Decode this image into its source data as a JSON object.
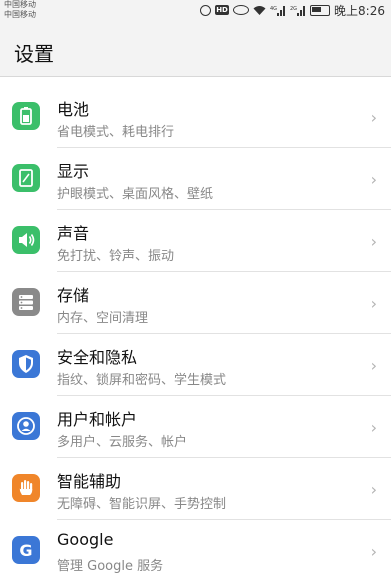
{
  "status_bar": {
    "carrier_1": "中国移动",
    "carrier_2": "中国移动",
    "time": "晚上8:26",
    "icons": [
      "alarm-icon",
      "hd-icon",
      "eye-icon",
      "wifi-icon",
      "signal-4g-icon",
      "signal-2g-icon",
      "battery-icon"
    ]
  },
  "header": {
    "title": "设置"
  },
  "settings": [
    {
      "title": "电池",
      "subtitle": "省电模式、耗电排行",
      "icon": "battery-icon",
      "color": "#3bbf6a"
    },
    {
      "title": "显示",
      "subtitle": "护眼模式、桌面风格、壁纸",
      "icon": "display-icon",
      "color": "#3bbf6a"
    },
    {
      "title": "声音",
      "subtitle": "免打扰、铃声、振动",
      "icon": "speaker-icon",
      "color": "#3bbf6a"
    },
    {
      "title": "存储",
      "subtitle": "内存、空间清理",
      "icon": "storage-icon",
      "color": "#8a8a8a"
    },
    {
      "title": "安全和隐私",
      "subtitle": "指纹、锁屏和密码、学生模式",
      "icon": "shield-icon",
      "color": "#3b77d6"
    },
    {
      "title": "用户和帐户",
      "subtitle": "多用户、云服务、帐户",
      "icon": "user-icon",
      "color": "#3b77d6"
    },
    {
      "title": "智能辅助",
      "subtitle": "无障碍、智能识屏、手势控制",
      "icon": "hand-icon",
      "color": "#f0862a"
    },
    {
      "title": "Google",
      "subtitle": "管理 Google 服务",
      "icon": "google-icon",
      "color": "#3b77d6"
    }
  ],
  "chevron": "›"
}
